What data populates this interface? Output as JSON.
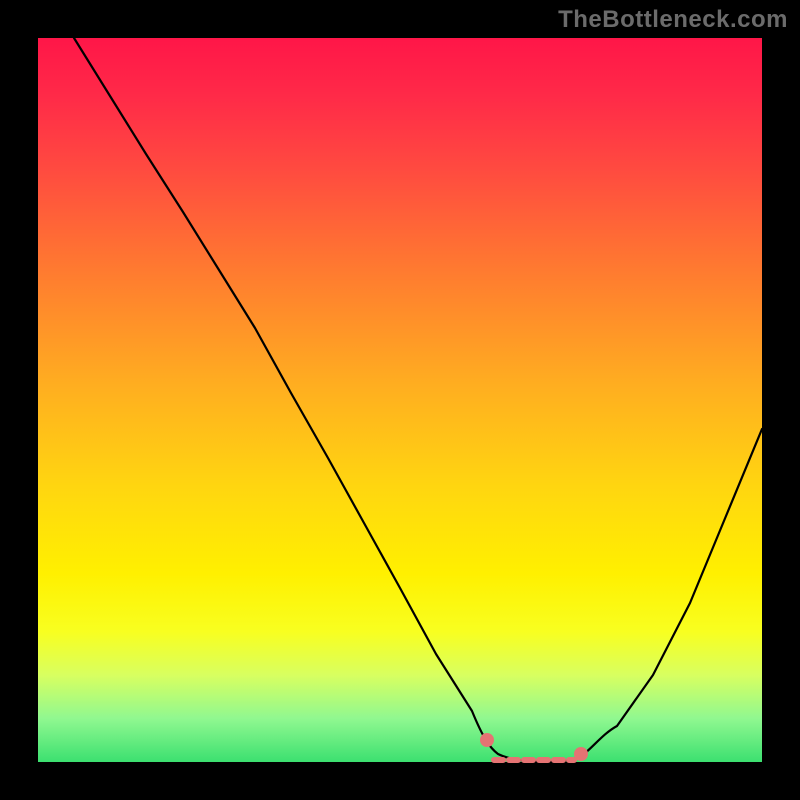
{
  "watermark": "TheBottleneck.com",
  "chart_data": {
    "type": "line",
    "title": "",
    "xlabel": "",
    "ylabel": "",
    "xlim": [
      0,
      100
    ],
    "ylim": [
      0,
      100
    ],
    "grid": false,
    "series": [
      {
        "name": "bottleneck-curve",
        "x": [
          5,
          10,
          15,
          20,
          25,
          30,
          35,
          40,
          45,
          50,
          55,
          60,
          62,
          65,
          68,
          72,
          75,
          80,
          85,
          90,
          95,
          100
        ],
        "values": [
          100,
          92,
          84,
          76,
          68,
          60,
          51,
          42,
          33,
          24,
          15,
          7,
          3,
          1,
          0,
          0,
          1,
          4,
          12,
          22,
          34,
          46
        ]
      }
    ],
    "annotations": [
      {
        "name": "optimal-marker-left",
        "x": 62,
        "value": 3,
        "color": "#e57373"
      },
      {
        "name": "optimal-marker-right",
        "x": 75,
        "value": 1,
        "color": "#e57373"
      }
    ],
    "optimal_band": {
      "x_start": 63,
      "x_end": 74,
      "color": "#e57373"
    }
  },
  "colors": {
    "curve": "#000000",
    "marker": "#e57373",
    "background_top": "#ff1648",
    "background_bottom": "#3ce070",
    "frame": "#000000"
  }
}
